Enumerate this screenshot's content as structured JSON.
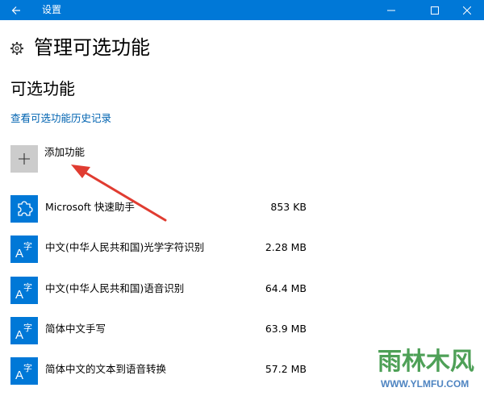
{
  "window": {
    "title": "设置"
  },
  "header": {
    "page_title": "管理可选功能"
  },
  "section": {
    "title": "可选功能",
    "history_link": "查看可选功能历史记录"
  },
  "add_feature": {
    "label": "添加功能"
  },
  "features": [
    {
      "name": "Microsoft 快速助手",
      "size": "853 KB",
      "icon": "puzzle-icon"
    },
    {
      "name": "中文(中华人民共和国)光学字符识别",
      "size": "2.28 MB",
      "icon": "language-icon"
    },
    {
      "name": "中文(中华人民共和国)语音识别",
      "size": "64.4 MB",
      "icon": "language-icon"
    },
    {
      "name": "简体中文手写",
      "size": "63.9 MB",
      "icon": "language-icon"
    },
    {
      "name": "简体中文的文本到语音转换",
      "size": "57.2 MB",
      "icon": "language-icon"
    }
  ],
  "watermark": {
    "text": "雨林木风",
    "url": "WWW.YLMFU.COM"
  },
  "colors": {
    "accent": "#0078d7",
    "link": "#0063b1",
    "annotation_arrow": "#e03c31"
  }
}
